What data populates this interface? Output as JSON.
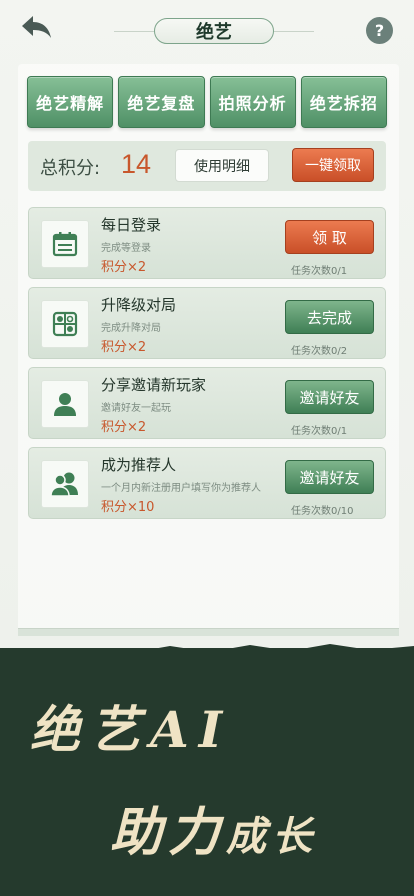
{
  "header": {
    "title": "绝艺",
    "back_icon": "back-arrow-icon",
    "help_label": "?"
  },
  "tabs": [
    {
      "label": "绝艺精解"
    },
    {
      "label": "绝艺复盘"
    },
    {
      "label": "拍照分析"
    },
    {
      "label": "绝艺拆招"
    }
  ],
  "score": {
    "label": "总积分:",
    "value": "14",
    "detail_button": "使用明细",
    "claim_all_button": "一键领取"
  },
  "tasks": [
    {
      "icon": "calendar-icon",
      "title": "每日登录",
      "desc": "完成等登录",
      "reward": "积分×2",
      "button": "领 取",
      "progress": "任务次数0/1",
      "button_style": "orange"
    },
    {
      "icon": "board-icon",
      "title": "升降级对局",
      "desc": "完成升降对局",
      "reward": "积分×2",
      "button": "去完成",
      "progress": "任务次数0/2",
      "button_style": "green"
    },
    {
      "icon": "user-icon",
      "title": "分享邀请新玩家",
      "desc": "邀请好友一起玩",
      "reward": "积分×2",
      "button": "邀请好友",
      "progress": "任务次数0/1",
      "button_style": "green"
    },
    {
      "icon": "users-icon",
      "title": "成为推荐人",
      "desc": "一个月内新注册用户填写你为推荐人",
      "reward": "积分×10",
      "button": "邀请好友",
      "progress": "任务次数0/10",
      "button_style": "green"
    }
  ],
  "banner": {
    "line1": "绝艺AI",
    "line2_main": "助力",
    "line2_small": "成长"
  },
  "colors": {
    "accent_green": "#4f9066",
    "accent_orange": "#c94f28",
    "banner_bg": "#253a2d",
    "banner_text": "#efe3c4"
  }
}
